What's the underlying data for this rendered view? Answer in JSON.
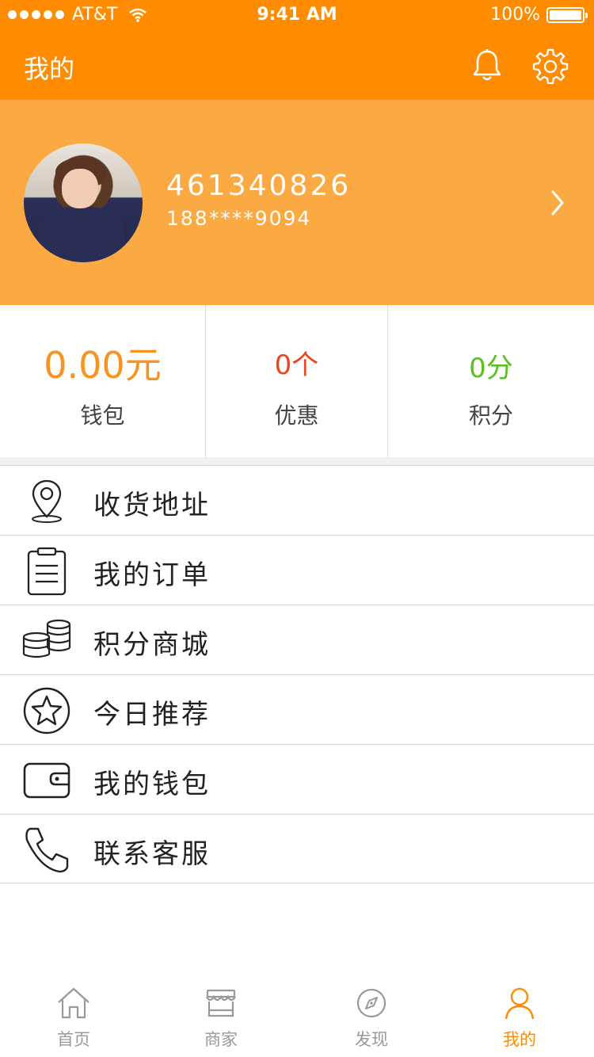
{
  "status_bar": {
    "carrier": "AT&T",
    "time": "9:41 AM",
    "battery": "100%"
  },
  "nav": {
    "title": "我的",
    "icons": [
      "bell-icon",
      "gear-icon"
    ]
  },
  "profile": {
    "user_id": "461340826",
    "phone": "188****9094"
  },
  "stats": [
    {
      "value": "0.00元",
      "label": "钱包",
      "color": "#f7931e"
    },
    {
      "value": "0个",
      "label": "优惠",
      "color": "#e8451f"
    },
    {
      "value": "0分",
      "label": "积分",
      "color": "#5bbf1f"
    }
  ],
  "menu": [
    {
      "label": "收货地址",
      "icon": "location-pin-icon"
    },
    {
      "label": "我的订单",
      "icon": "clipboard-icon"
    },
    {
      "label": "积分商城",
      "icon": "coins-icon"
    },
    {
      "label": "今日推荐",
      "icon": "star-icon"
    },
    {
      "label": "我的钱包",
      "icon": "wallet-icon"
    },
    {
      "label": "联系客服",
      "icon": "phone-icon"
    }
  ],
  "tabbar": [
    {
      "label": "首页",
      "icon": "home-icon",
      "active": false
    },
    {
      "label": "商家",
      "icon": "store-icon",
      "active": false
    },
    {
      "label": "发现",
      "icon": "compass-icon",
      "active": false
    },
    {
      "label": "我的",
      "icon": "user-icon",
      "active": true
    }
  ],
  "colors": {
    "brand": "#ff8c00",
    "profile_bg": "#fba942",
    "active_tab": "#ff8c00"
  }
}
